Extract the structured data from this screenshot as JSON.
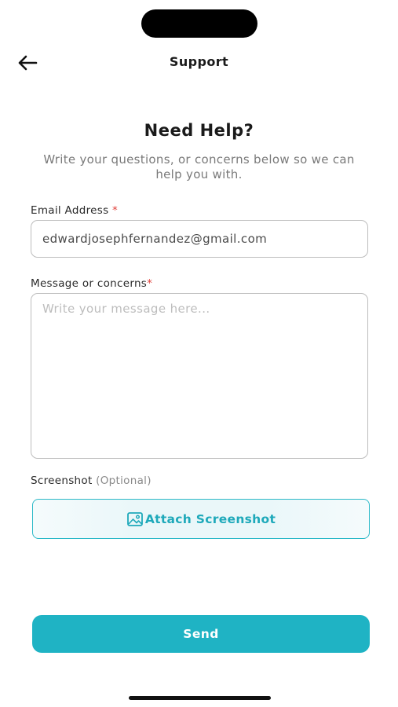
{
  "nav": {
    "title": "Support",
    "back_icon": "arrow-left-icon"
  },
  "intro": {
    "heading": "Need Help?",
    "subtitle": "Write your questions, or concerns below so we can help you with."
  },
  "form": {
    "email": {
      "label": "Email Address",
      "required_mark": "*",
      "value": "edwardjosephfernandez@gmail.com"
    },
    "message": {
      "label": "Message or concerns",
      "required_mark": "*",
      "placeholder": "Write your message here..."
    },
    "screenshot": {
      "label": "Screenshot",
      "optional_text": "(Optional)",
      "attach_label": "Attach Screenshot",
      "attach_icon": "image-icon"
    },
    "send_label": "Send"
  },
  "colors": {
    "accent": "#1fb3c4",
    "accent_text": "#1ea9ba",
    "required": "#e0403a"
  }
}
